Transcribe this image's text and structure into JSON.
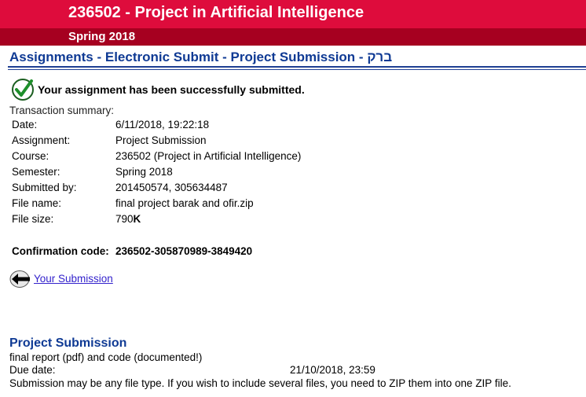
{
  "header": {
    "course_title": "236502 - Project in Artificial Intelligence",
    "semester": "Spring 2018"
  },
  "breadcrumb": "Assignments - Electronic Submit - Project Submission - ברק",
  "success_message": "Your assignment has been successfully submitted.",
  "summary": {
    "title": "Transaction summary:",
    "rows": [
      {
        "label": "Date:",
        "value": "6/11/2018, 19:22:18"
      },
      {
        "label": "Assignment:",
        "value": "Project Submission"
      },
      {
        "label": "Course:",
        "value": "236502 (Project in Artificial Intelligence)"
      },
      {
        "label": "Semester:",
        "value": "Spring 2018"
      },
      {
        "label": "Submitted by:",
        "value": "201450574, 305634487"
      },
      {
        "label": "File name:",
        "value": "final project barak and ofir.zip"
      }
    ],
    "file_size_label": "File size:",
    "file_size_number": "790",
    "file_size_unit": "K",
    "confirmation_label": "Confirmation code:",
    "confirmation_value": "236502-305870989-3849420"
  },
  "back_link": "Your Submission",
  "project": {
    "title": "Project Submission",
    "description": "final report (pdf) and code (documented!)",
    "due_label": "Due date:",
    "due_value": "21/10/2018, 23:59",
    "note": "Submission may be any file type. If you wish to include several files, you need to ZIP them into one ZIP file."
  },
  "colors": {
    "header_red": "#de0c3c",
    "header_dark_red": "#a60020",
    "title_blue": "#0f3a94",
    "check_green": "#1d8f2a"
  },
  "icons": [
    "check-icon",
    "back-arrow-icon"
  ]
}
